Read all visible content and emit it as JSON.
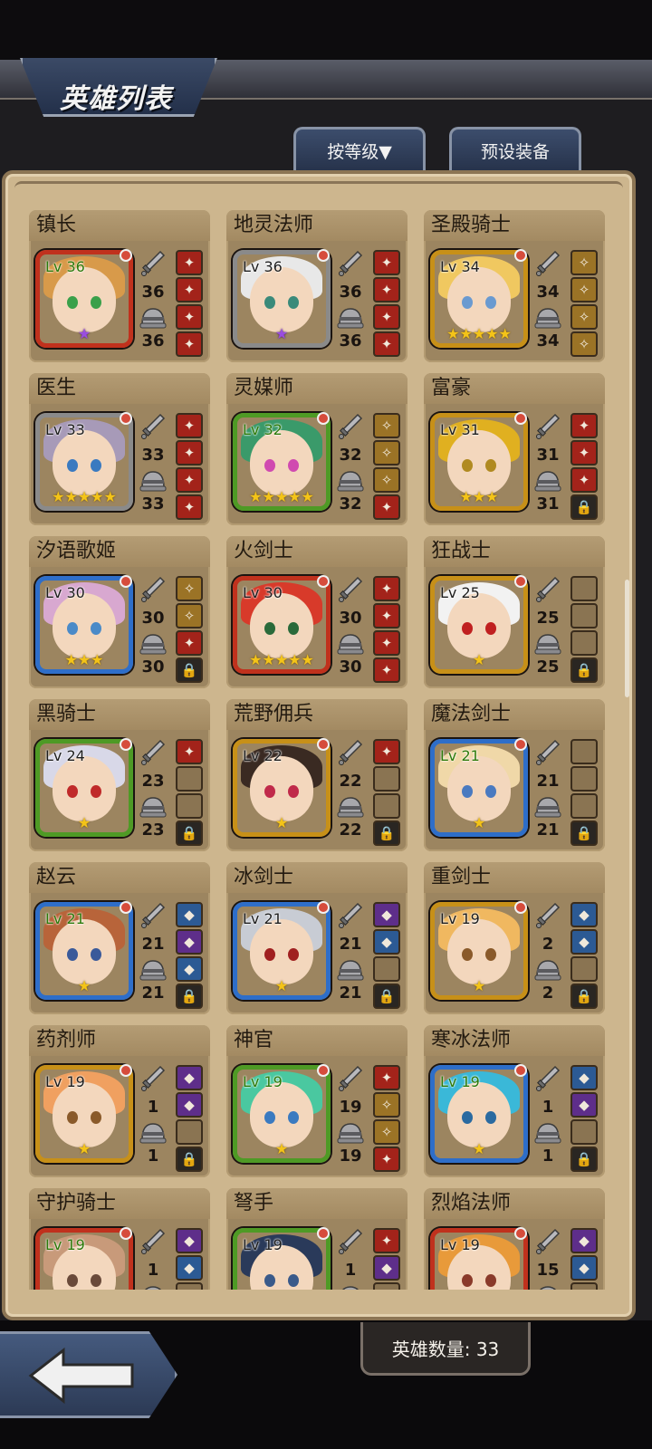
{
  "header": {
    "title": "英雄列表"
  },
  "toolbar": {
    "sort_label": "按等级▼",
    "preset_label": "预设装备"
  },
  "footer": {
    "hero_count_label": "英雄数量: 33"
  },
  "colors": {
    "panel": "#cdb68e",
    "card": "#9c8560",
    "star": "#f4c418",
    "level_green": "#2d7a0a"
  },
  "heroes": [
    {
      "name": "镇长",
      "level": "Lv 36",
      "weapon": "36",
      "armor": "36",
      "frame": "red",
      "stars": "★",
      "star_color": "purple",
      "lv_color": "green",
      "hair": "#d89a4a",
      "eye": "#3aa04a",
      "slots": [
        "red",
        "red",
        "red",
        "red"
      ]
    },
    {
      "name": "地灵法师",
      "level": "Lv 36",
      "weapon": "36",
      "armor": "36",
      "frame": "gray",
      "stars": "★",
      "star_color": "purple",
      "lv_color": "",
      "hair": "#e8e8e8",
      "eye": "#3a8a7a",
      "slots": [
        "red",
        "red",
        "red",
        "red"
      ]
    },
    {
      "name": "圣殿骑士",
      "level": "Lv 34",
      "weapon": "34",
      "armor": "34",
      "frame": "gold",
      "stars": "★★★★★",
      "star_color": "",
      "lv_color": "",
      "hair": "#f0c860",
      "eye": "#6a9ad0",
      "slots": [
        "gold",
        "gold",
        "gold",
        "gold"
      ]
    },
    {
      "name": "医生",
      "level": "Lv 33",
      "weapon": "33",
      "armor": "33",
      "frame": "gray",
      "stars": "★★★★★",
      "star_color": "",
      "lv_color": "",
      "hair": "#a79ab8",
      "eye": "#3a7ac0",
      "slots": [
        "red",
        "red",
        "red",
        "red"
      ]
    },
    {
      "name": "灵媒师",
      "level": "Lv 32",
      "weapon": "32",
      "armor": "32",
      "frame": "green",
      "stars": "★★★★★",
      "star_color": "",
      "lv_color": "green",
      "hair": "#3a9a6a",
      "eye": "#d04ab0",
      "slots": [
        "gold",
        "gold",
        "gold",
        "red"
      ]
    },
    {
      "name": "富豪",
      "level": "Lv 31",
      "weapon": "31",
      "armor": "31",
      "frame": "gold",
      "stars": "★★★",
      "star_color": "",
      "lv_color": "",
      "hair": "#e0b020",
      "eye": "#b08a20",
      "slots": [
        "red",
        "red",
        "red",
        "lock"
      ]
    },
    {
      "name": "汐语歌姬",
      "level": "Lv 30",
      "weapon": "30",
      "armor": "30",
      "frame": "blue",
      "stars": "★★★",
      "star_color": "",
      "lv_color": "",
      "hair": "#d8a8d0",
      "eye": "#4a8ac8",
      "slots": [
        "gold",
        "gold",
        "red",
        "lock"
      ]
    },
    {
      "name": "火剑士",
      "level": "Lv 30",
      "weapon": "30",
      "armor": "30",
      "frame": "red",
      "stars": "★★★★★",
      "star_color": "",
      "lv_color": "",
      "hair": "#d83a2a",
      "eye": "#2a6a3a",
      "slots": [
        "red",
        "red",
        "red",
        "red"
      ]
    },
    {
      "name": "狂战士",
      "level": "Lv 25",
      "weapon": "25",
      "armor": "25",
      "frame": "gold",
      "stars": "★",
      "star_color": "",
      "lv_color": "",
      "hair": "#f2f2f2",
      "eye": "#c02020",
      "slots": [
        "empty",
        "empty",
        "empty",
        "lock"
      ]
    },
    {
      "name": "黑骑士",
      "level": "Lv 24",
      "weapon": "23",
      "armor": "23",
      "frame": "green",
      "stars": "★",
      "star_color": "",
      "lv_color": "",
      "hair": "#d8d8e8",
      "eye": "#c02a2a",
      "slots": [
        "red",
        "empty",
        "empty",
        "lock"
      ]
    },
    {
      "name": "荒野佣兵",
      "level": "Lv 22",
      "weapon": "22",
      "armor": "22",
      "frame": "gold",
      "stars": "★",
      "star_color": "",
      "lv_color": "",
      "hair": "#3a2a22",
      "eye": "#c02a4a",
      "slots": [
        "red",
        "empty",
        "empty",
        "lock"
      ]
    },
    {
      "name": "魔法剑士",
      "level": "Lv 21",
      "weapon": "21",
      "armor": "21",
      "frame": "blue",
      "stars": "★",
      "star_color": "",
      "lv_color": "green",
      "hair": "#f0d8a8",
      "eye": "#4a7ac0",
      "slots": [
        "empty",
        "empty",
        "empty",
        "lock"
      ]
    },
    {
      "name": "赵云",
      "level": "Lv 21",
      "weapon": "21",
      "armor": "21",
      "frame": "blue",
      "stars": "★",
      "star_color": "",
      "lv_color": "green",
      "hair": "#b8643a",
      "eye": "#3a5a9a",
      "slots": [
        "blue",
        "purple",
        "blue",
        "lock"
      ]
    },
    {
      "name": "冰剑士",
      "level": "Lv 21",
      "weapon": "21",
      "armor": "21",
      "frame": "blue",
      "stars": "★",
      "star_color": "",
      "lv_color": "",
      "hair": "#c8ccd4",
      "eye": "#a02020",
      "slots": [
        "purple",
        "blue",
        "empty",
        "lock"
      ]
    },
    {
      "name": "重剑士",
      "level": "Lv 19",
      "weapon": "2",
      "armor": "2",
      "frame": "gold",
      "stars": "★",
      "star_color": "",
      "lv_color": "",
      "hair": "#f0b860",
      "eye": "#8a5a2a",
      "slots": [
        "blue",
        "blue",
        "empty",
        "lock"
      ]
    },
    {
      "name": "药剂师",
      "level": "Lv 19",
      "weapon": "1",
      "armor": "1",
      "frame": "gold",
      "stars": "★",
      "star_color": "",
      "lv_color": "",
      "hair": "#f0a060",
      "eye": "#8a5a2a",
      "slots": [
        "purple",
        "purple",
        "empty",
        "lock"
      ]
    },
    {
      "name": "神官",
      "level": "Lv 19",
      "weapon": "19",
      "armor": "19",
      "frame": "green",
      "stars": "★",
      "star_color": "",
      "lv_color": "green",
      "hair": "#4ac8a0",
      "eye": "#3a7ac0",
      "slots": [
        "red",
        "gold",
        "gold",
        "red"
      ]
    },
    {
      "name": "寒冰法师",
      "level": "Lv 19",
      "weapon": "1",
      "armor": "1",
      "frame": "blue",
      "stars": "★",
      "star_color": "",
      "lv_color": "green",
      "hair": "#3ab8d8",
      "eye": "#2a6aa0",
      "slots": [
        "blue",
        "purple",
        "empty",
        "lock"
      ]
    },
    {
      "name": "守护骑士",
      "level": "Lv 19",
      "weapon": "1",
      "armor": "",
      "frame": "red",
      "stars": "",
      "star_color": "",
      "lv_color": "green",
      "hair": "#c89a7a",
      "eye": "#6a4a3a",
      "slots": [
        "purple",
        "blue",
        "empty",
        "lock"
      ]
    },
    {
      "name": "弩手",
      "level": "Lv 19",
      "weapon": "1",
      "armor": "",
      "frame": "green",
      "stars": "",
      "star_color": "",
      "lv_color": "",
      "hair": "#2a3a5a",
      "eye": "#3a5a8a",
      "slots": [
        "red",
        "purple",
        "empty",
        "lock"
      ]
    },
    {
      "name": "烈焰法师",
      "level": "Lv 19",
      "weapon": "15",
      "armor": "",
      "frame": "red",
      "stars": "",
      "star_color": "",
      "lv_color": "",
      "hair": "#e89a3a",
      "eye": "#8a3a2a",
      "slots": [
        "purple",
        "blue",
        "empty",
        "lock"
      ]
    }
  ]
}
